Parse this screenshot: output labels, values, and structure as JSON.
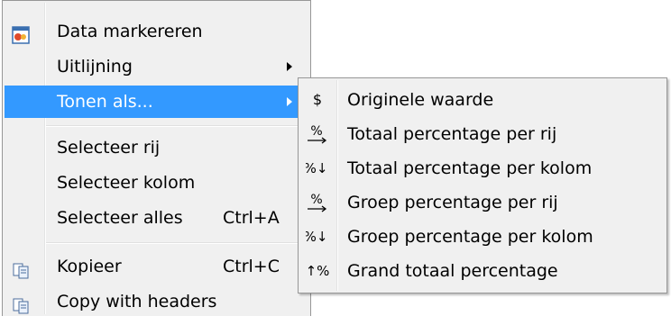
{
  "main_menu": {
    "items": [
      {
        "label": "Data markereren",
        "icon": "highlight-data-icon"
      },
      {
        "label": "Uitlijning",
        "submenu": true
      },
      {
        "label": "Tonen als...",
        "submenu": true,
        "highlighted": true
      },
      {
        "label": "Selecteer rij"
      },
      {
        "label": "Selecteer kolom"
      },
      {
        "label": "Selecteer alles",
        "shortcut": "Ctrl+A"
      },
      {
        "label": "Kopieer",
        "shortcut": "Ctrl+C",
        "icon": "copy-icon"
      },
      {
        "label": "Copy with headers",
        "icon": "copy-headers-icon"
      }
    ]
  },
  "submenu": {
    "items": [
      {
        "label": "Originele waarde",
        "icon_text": "$",
        "icon": "dollar-icon"
      },
      {
        "label": "Totaal percentage per rij",
        "icon_text": "%",
        "icon": "percent-row-icon"
      },
      {
        "label": "Totaal percentage per kolom",
        "icon_text": "%↓",
        "icon": "percent-column-icon"
      },
      {
        "label": "Groep percentage per rij",
        "icon_text": "%",
        "icon": "group-percent-row-icon"
      },
      {
        "label": "Groep percentage per kolom",
        "icon_text": "%↓",
        "icon": "group-percent-column-icon"
      },
      {
        "label": "Grand totaal percentage",
        "icon_text": "↑%",
        "icon": "grand-total-percent-icon"
      }
    ]
  },
  "colors": {
    "menu_background": "#f0f0f0",
    "highlight": "#3399ff",
    "border": "#979797"
  }
}
